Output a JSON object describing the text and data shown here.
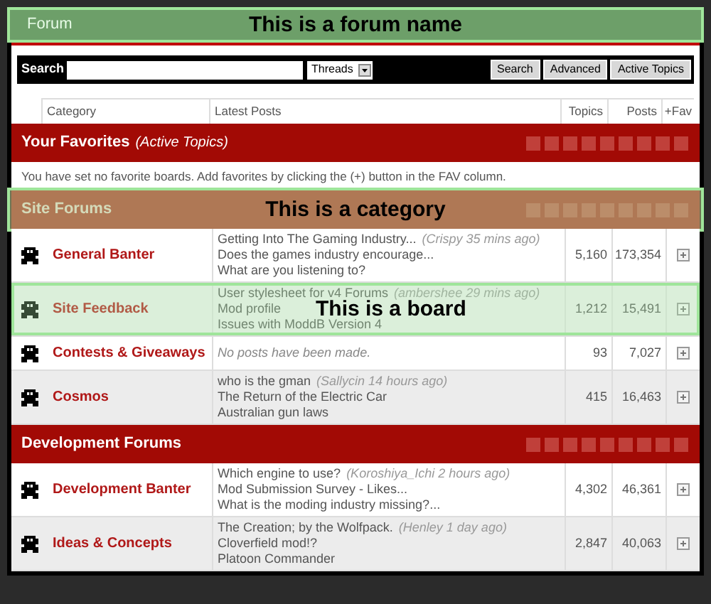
{
  "header": {
    "title": "Forum",
    "annotation": "This is a forum name"
  },
  "search": {
    "label": "Search",
    "scope": "Threads",
    "buttons": [
      "Search",
      "Advanced",
      "Active Topics"
    ]
  },
  "columns": [
    "Category",
    "Latest Posts",
    "Topics",
    "Posts",
    "+Fav"
  ],
  "sections": [
    {
      "title": "Your Favorites",
      "subtitle": "(Active Topics)",
      "message": "You have set no favorite boards. Add favorites by clicking the (+) button in the FAV column."
    },
    {
      "title": "Site Forums",
      "annotation": "This is a category",
      "boards": [
        {
          "name": "General Banter",
          "latest": [
            {
              "title": "Getting Into The Gaming Industry...",
              "meta": "(Crispy 35 mins ago)"
            },
            {
              "title": "Does the games industry encourage..."
            },
            {
              "title": "What are you listening to?"
            }
          ],
          "topics": "5,160",
          "posts": "173,354"
        },
        {
          "name": "Site Feedback",
          "annotation": "This is a board",
          "latest": [
            {
              "title": "User stylesheet for v4 Forums",
              "meta": "(ambershee 29 mins ago)"
            },
            {
              "title": "Mod profile"
            },
            {
              "title": "Issues with ModdB Version 4"
            }
          ],
          "topics": "1,212",
          "posts": "15,491"
        },
        {
          "name": "Contests & Giveaways",
          "empty": "No posts have been made.",
          "topics": "93",
          "posts": "7,027"
        },
        {
          "name": "Cosmos",
          "latest": [
            {
              "title": "who is the gman",
              "meta": "(Sallycin 14 hours ago)"
            },
            {
              "title": "The Return of the Electric Car"
            },
            {
              "title": "Australian gun laws"
            }
          ],
          "topics": "415",
          "posts": "16,463"
        }
      ]
    },
    {
      "title": "Development Forums",
      "boards": [
        {
          "name": "Development Banter",
          "latest": [
            {
              "title": "Which engine to use?",
              "meta": "(Koroshiya_Ichi 2 hours ago)"
            },
            {
              "title": "Mod Submission Survey - Likes..."
            },
            {
              "title": "What is the moding industry missing?..."
            }
          ],
          "topics": "4,302",
          "posts": "46,361"
        },
        {
          "name": "Ideas & Concepts",
          "latest": [
            {
              "title": "The Creation; by the Wolfpack.",
              "meta": "(Henley 1 day ago)"
            },
            {
              "title": "Cloverfield mod!?"
            },
            {
              "title": "Platoon Commander"
            }
          ],
          "topics": "2,847",
          "posts": "40,063"
        }
      ]
    }
  ]
}
